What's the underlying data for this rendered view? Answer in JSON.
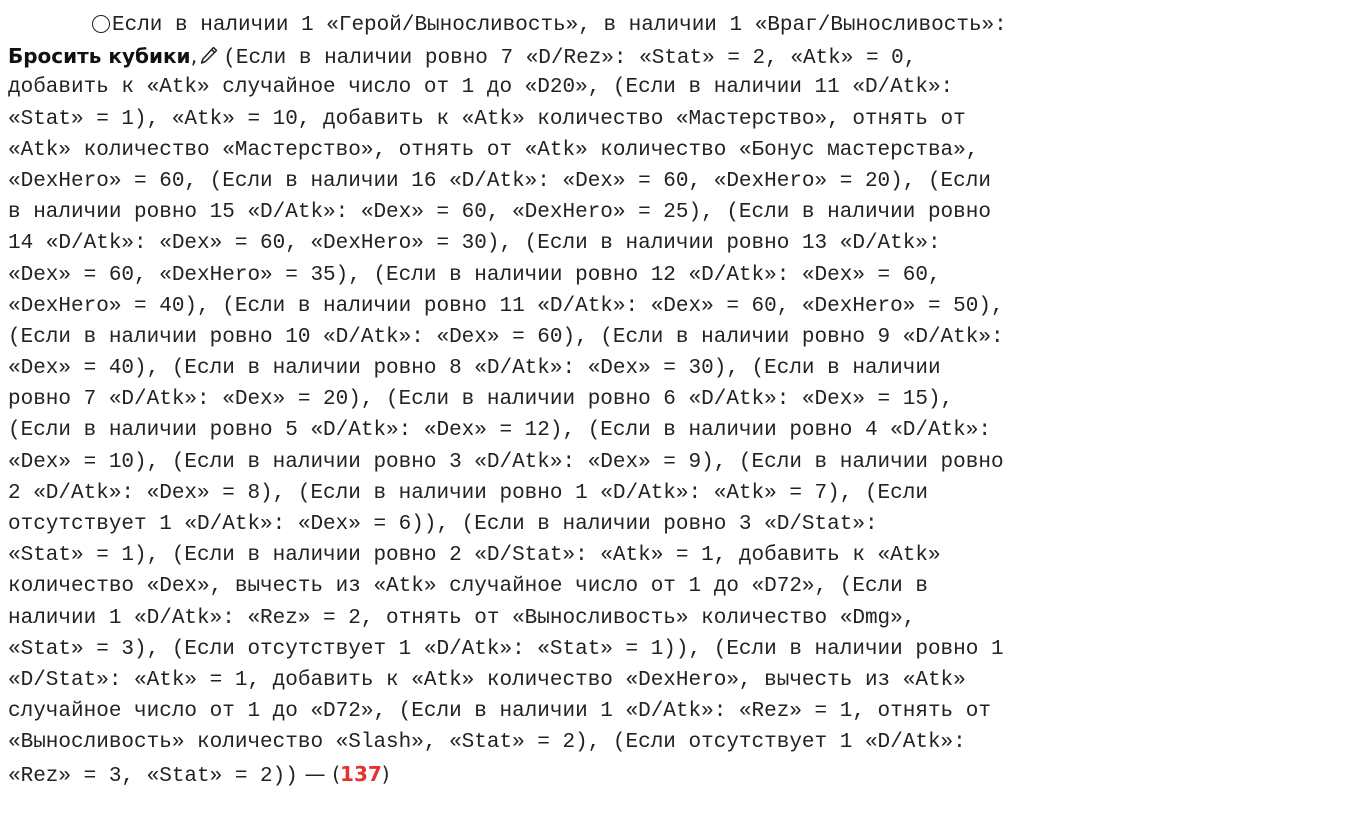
{
  "lines": [
    "Если в наличии 1 «Герой/Выносливость», в наличии 1 «Враг/Выносливость»:",
    "(Если в наличии ровно 7 «D/Rez»: «Stat» = 2, «Atk» = 0,",
    "добавить к «Atk» случайное число от 1 до «D20», (Если в наличии 11 «D/Atk»:",
    "«Stat» = 1), «Atk» = 10, добавить к «Atk» количество «Мастерство», отнять от",
    "«Atk» количество «Мастерство», отнять от «Atk» количество «Бонус мастерства»,",
    "«DexHero» = 60, (Если в наличии 16 «D/Atk»: «Dex» = 60, «DexHero» = 20), (Если",
    "в наличии ровно 15 «D/Atk»: «Dex» = 60, «DexHero» = 25), (Если в наличии ровно",
    "14 «D/Atk»: «Dex» = 60, «DexHero» = 30), (Если в наличии ровно 13 «D/Atk»:",
    "«Dex» = 60, «DexHero» = 35), (Если в наличии ровно 12 «D/Atk»: «Dex» = 60,",
    "«DexHero» = 40), (Если в наличии ровно 11 «D/Atk»: «Dex» = 60, «DexHero» = 50),",
    "(Если в наличии ровно 10 «D/Atk»: «Dex» = 60), (Если в наличии ровно 9 «D/Atk»:",
    "«Dex» = 40), (Если в наличии ровно 8 «D/Atk»: «Dex» = 30), (Если в наличии",
    "ровно 7 «D/Atk»: «Dex» = 20), (Если в наличии ровно 6 «D/Atk»: «Dex» = 15),",
    "(Если в наличии ровно 5 «D/Atk»: «Dex» = 12), (Если в наличии ровно 4 «D/Atk»:",
    "«Dex» = 10), (Если в наличии ровно 3 «D/Atk»: «Dex» = 9), (Если в наличии ровно",
    "2 «D/Atk»: «Dex» = 8), (Если в наличии ровно 1 «D/Atk»: «Atk» = 7), (Если",
    "отсутствует 1 «D/Atk»: «Dex» = 6)), (Если в наличии ровно 3 «D/Stat»:",
    "«Stat» = 1), (Если в наличии ровно 2 «D/Stat»: «Atk» = 1, добавить к «Atk»",
    "количество «Dex», вычесть из «Atk» случайное число от 1 до «D72», (Если в",
    "наличии 1 «D/Atk»: «Rez» = 2, отнять от «Выносливость» количество «Dmg»,",
    "«Stat» = 3), (Если отсутствует 1 «D/Atk»: «Stat» = 1)), (Если в наличии ровно 1",
    "«D/Stat»: «Atk» = 1, добавить к «Atk» количество «DexHero», вычесть из «Atk»",
    "случайное число от 1 до «D72», (Если в наличии 1 «D/Atk»: «Rez» = 1, отнять от",
    "«Выносливость» количество «Slash», «Stat» = 2), (Если отсутствует 1 «D/Atk»:",
    "«Rez» = 3, «Stat» = 2))"
  ],
  "action_label": "Бросить кубики",
  "action_comma": ",",
  "dash": " — ",
  "ref_open": "(",
  "ref_number": "137",
  "ref_close": ")",
  "icons": {
    "circle": "circle-outline-icon",
    "edit": "pencil-icon"
  },
  "colors": {
    "text": "#222222",
    "ref_number": "#e5322d"
  }
}
